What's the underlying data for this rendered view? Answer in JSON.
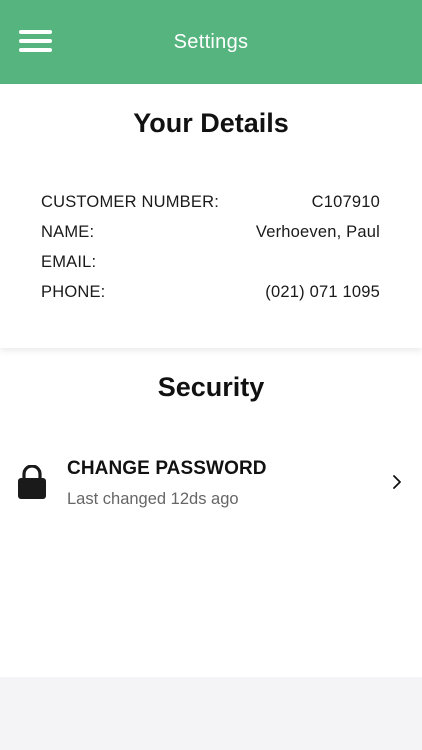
{
  "header": {
    "title": "Settings",
    "menu_icon": "hamburger-menu-icon",
    "background_color": "#56b47f"
  },
  "details": {
    "title": "Your Details",
    "rows": [
      {
        "label": "CUSTOMER NUMBER:",
        "value": "C107910"
      },
      {
        "label": "NAME:",
        "value": "Verhoeven, Paul"
      },
      {
        "label": "EMAIL:",
        "value": ""
      },
      {
        "label": "PHONE:",
        "value": "(021) 071 1095"
      }
    ]
  },
  "security": {
    "title": "Security",
    "change_password": {
      "icon": "lock-icon",
      "title": "CHANGE PASSWORD",
      "subtitle": "Last changed 12ds ago",
      "chevron_icon": "chevron-right-icon"
    }
  }
}
